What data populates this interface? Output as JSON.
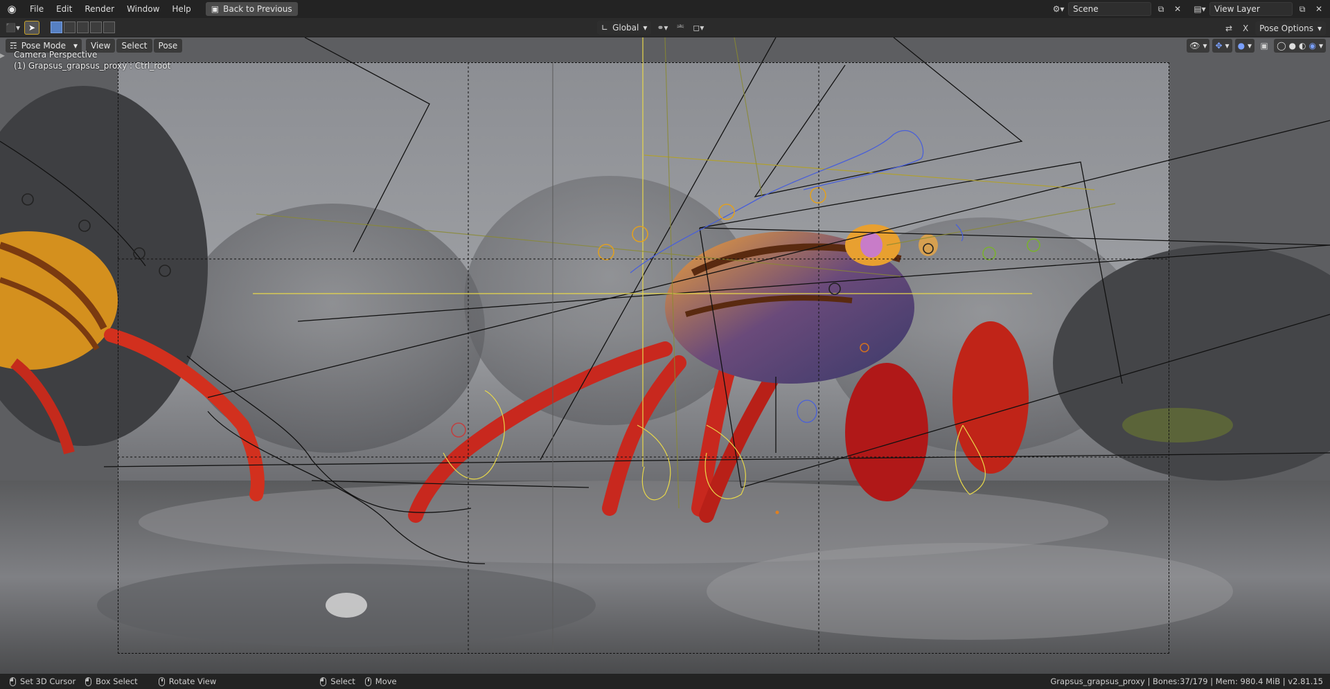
{
  "app": {
    "logo_icon": "blender-logo-icon"
  },
  "menubar": {
    "items": [
      "File",
      "Edit",
      "Render",
      "Window",
      "Help"
    ],
    "back_button": "Back to Previous"
  },
  "scene": {
    "label": "Scene",
    "view_layer": "View Layer"
  },
  "toolbar": {
    "transform_orientation": "Global",
    "pose_options": "Pose Options"
  },
  "viewport": {
    "mode": "Pose Mode",
    "menus": [
      "View",
      "Select",
      "Pose"
    ],
    "camera_label": "Camera Perspective",
    "active_object": "(1) Grapsus_grapsus_proxy : Ctrl_root"
  },
  "statusbar": {
    "items": [
      {
        "icon": "left",
        "label": "Set 3D Cursor"
      },
      {
        "icon": "left",
        "label": "Box Select"
      },
      {
        "icon": "middle",
        "label": "Rotate View"
      },
      {
        "icon": "left",
        "label": "Select"
      },
      {
        "icon": "middle",
        "label": "Move"
      }
    ],
    "info": "Grapsus_grapsus_proxy | Bones:37/179 | Mem: 980.4 MiB | v2.81.15"
  },
  "colors": {
    "accent": "#c9a42b",
    "selected_blue": "#5680c2",
    "crab_red": "#c8281e",
    "crab_orange": "#e8a030"
  }
}
